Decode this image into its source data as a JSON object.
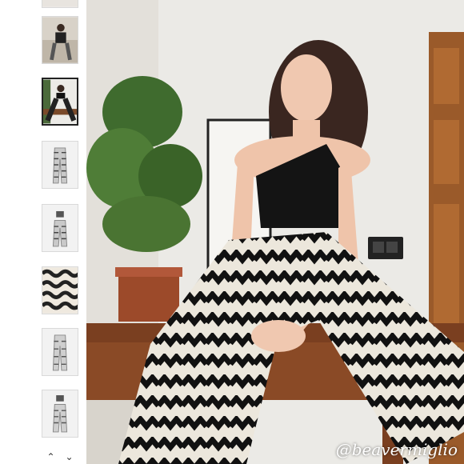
{
  "gallery": {
    "thumbnails": [
      {
        "name": "thumb-outfit-seated",
        "selected": false
      },
      {
        "name": "thumb-outfit-front",
        "selected": true
      },
      {
        "name": "thumb-trousers-front",
        "selected": false
      },
      {
        "name": "thumb-set-flat",
        "selected": false
      },
      {
        "name": "thumb-fabric-detail",
        "selected": false
      },
      {
        "name": "thumb-trousers-back",
        "selected": false
      },
      {
        "name": "thumb-set-back",
        "selected": false
      }
    ],
    "nav_up_icon": "chevron-up-icon",
    "nav_down_icon": "chevron-down-icon"
  },
  "main_image": {
    "watermark": "@beavermiglio"
  }
}
